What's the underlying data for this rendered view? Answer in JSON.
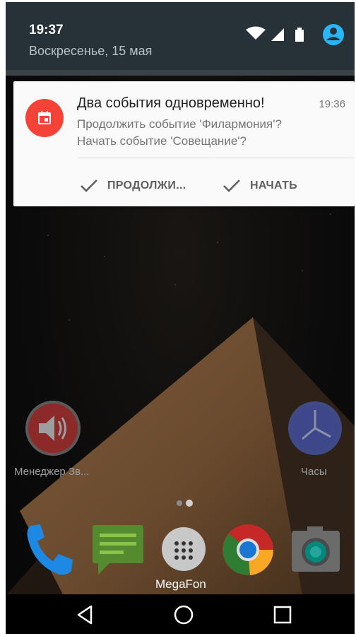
{
  "status": {
    "time": "19:37",
    "date": "Воскресенье, 15 мая",
    "icons": [
      "wifi-icon",
      "signal-icon",
      "battery-icon",
      "account-icon"
    ]
  },
  "notification": {
    "app_icon": "calendar-icon",
    "title": "Два события одновременно!",
    "time": "19:36",
    "line1": "Продолжить событие 'Филармония'?",
    "line2": "Начать событие 'Совещание'?",
    "actions": [
      {
        "label": "ПРОДОЛЖИ...",
        "icon": "check-icon"
      },
      {
        "label": "НАЧАТЬ",
        "icon": "check-icon"
      }
    ]
  },
  "home": {
    "apps": [
      {
        "label": "Менеджер Зв...",
        "icon": "speaker-icon"
      },
      {
        "label": "Часы",
        "icon": "clock-icon"
      }
    ],
    "dock": [
      {
        "icon": "phone-icon"
      },
      {
        "icon": "messages-icon"
      },
      {
        "label": "MegaFon",
        "icon": "app-drawer-icon"
      },
      {
        "icon": "chrome-icon"
      },
      {
        "icon": "camera-icon"
      }
    ]
  },
  "navbar": {
    "buttons": [
      "back-icon",
      "home-icon",
      "recents-icon"
    ]
  },
  "colors": {
    "shade": "#263238",
    "accent": "#f44336",
    "card": "#fafafa"
  }
}
